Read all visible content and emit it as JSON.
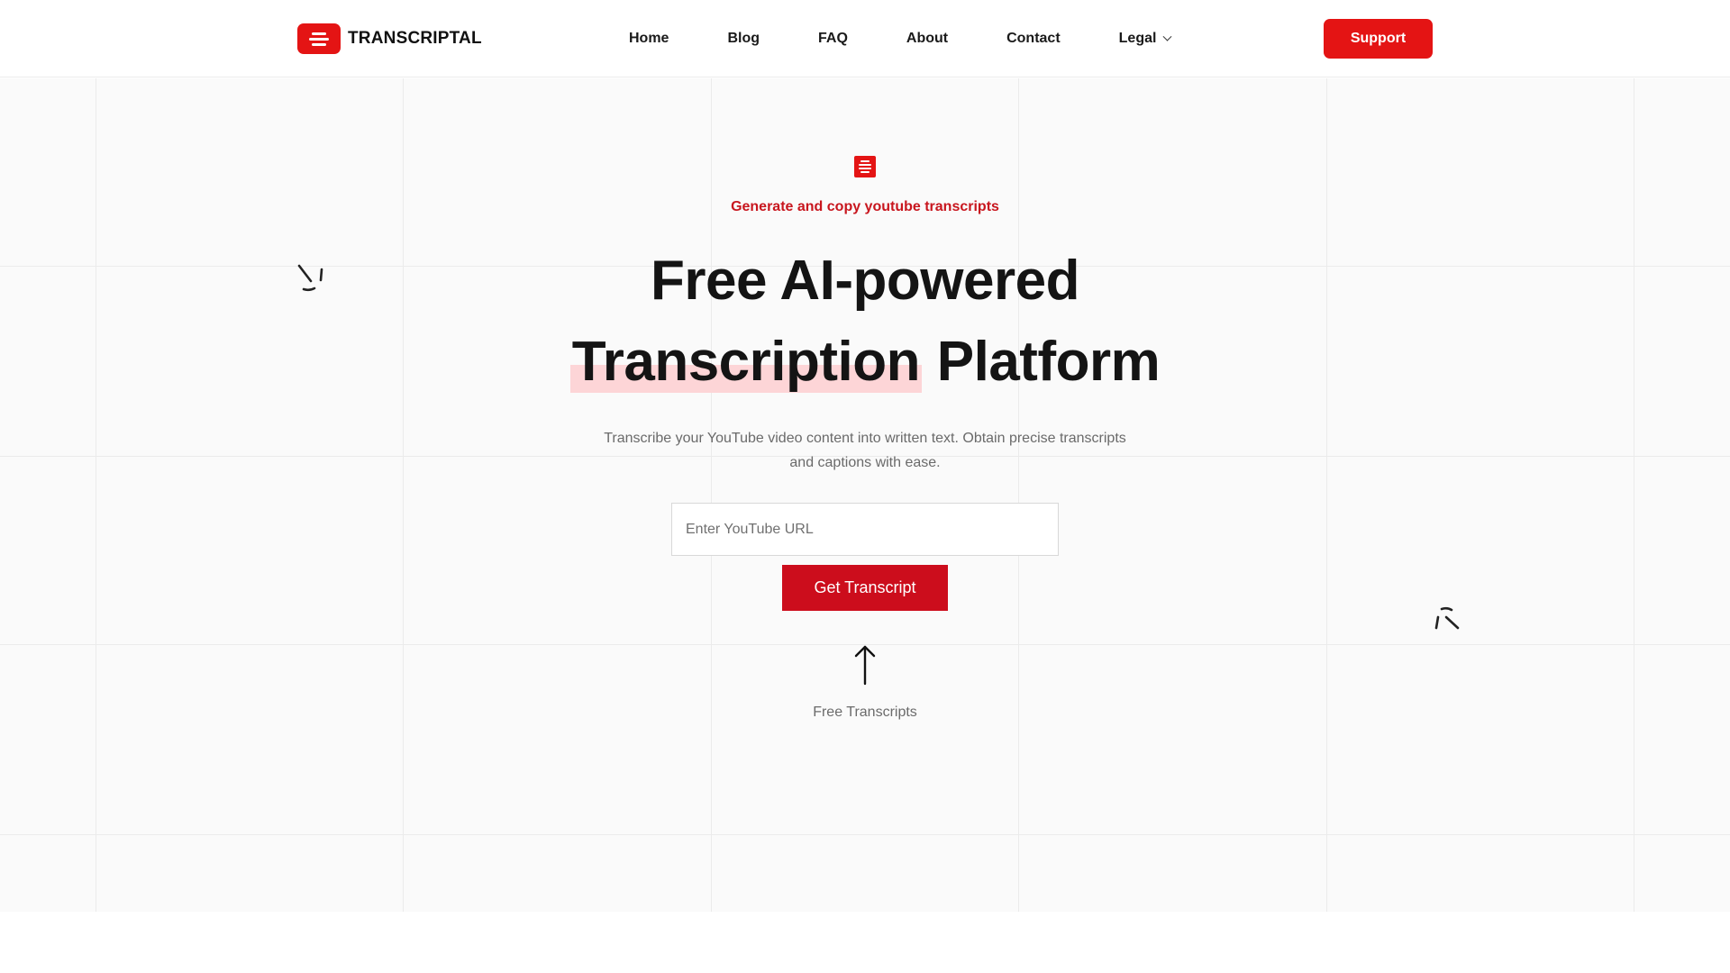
{
  "header": {
    "brand": "TRANSCRIPTAL",
    "nav": [
      {
        "label": "Home"
      },
      {
        "label": "Blog"
      },
      {
        "label": "FAQ"
      },
      {
        "label": "About"
      },
      {
        "label": "Contact"
      },
      {
        "label": "Legal"
      }
    ],
    "support_label": "Support"
  },
  "hero": {
    "tagline": "Generate and copy youtube transcripts",
    "headline_line1": "Free AI-powered",
    "headline_highlight": "Transcription",
    "headline_rest": "Platform",
    "subtext": "Transcribe your YouTube video content into written text. Obtain precise transcripts and captions with ease.",
    "url_placeholder": "Enter YouTube URL",
    "submit_label": "Get Transcript",
    "arrow_caption": "Free Transcripts"
  },
  "colors": {
    "brand_red": "#e41414",
    "button_red": "#cc0d1c",
    "highlight_pink": "#fdd5d7",
    "tagline_red": "#c8161e"
  },
  "icons": {
    "logo": "transcript-lines-icon",
    "legal_dropdown": "chevron-down-icon",
    "arrow": "arrow-up-icon",
    "decorations": [
      "sparkle-icon",
      "sparkle-icon"
    ]
  }
}
